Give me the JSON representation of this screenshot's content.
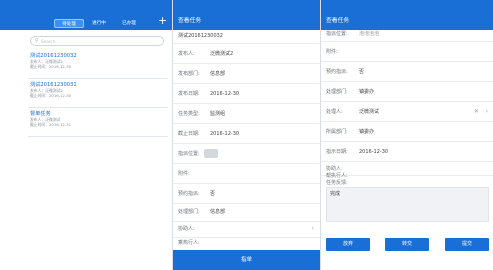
{
  "list_panel": {
    "tabs": [
      "待处理",
      "进行中",
      "已办理"
    ],
    "add_label": "+",
    "search_placeholder": "Search",
    "tasks": [
      {
        "title": "测试20161230032",
        "publisher": "发布人：泛微测试2",
        "deadline": "截止时间：2016-12-30"
      },
      {
        "title": "测试20161230031",
        "publisher": "发布人：泛微测试2",
        "deadline": "截止时间：2016-12-30"
      },
      {
        "title": "督单任务",
        "publisher": "发布人：泛微测试",
        "deadline": "截止时间：2016-12-31"
      }
    ]
  },
  "detail_panel": {
    "title": "查看任务",
    "task_name": "测试20161230032",
    "fields": [
      {
        "label": "发布人:",
        "value": "泛微测试2"
      },
      {
        "label": "发布部门:",
        "value": "信息部"
      },
      {
        "label": "发布日期:",
        "value": "2016-12-30"
      },
      {
        "label": "任务类型:",
        "value": "监测组"
      },
      {
        "label": "截止日期:",
        "value": "2016-12-30"
      },
      {
        "label": "指派位置:",
        "value": ""
      },
      {
        "label": "附件:",
        "value": ""
      },
      {
        "label": "预约指派:",
        "value": "否"
      },
      {
        "label": "处理部门:",
        "value": "信息部"
      },
      {
        "label": "协助人:",
        "value": ""
      },
      {
        "label": "乘热行人:",
        "value": ""
      }
    ],
    "bottom_button": "指单"
  },
  "process_panel": {
    "title": "查看任务",
    "fields": [
      {
        "label": "指派位置:",
        "value": "泡泡泡泡"
      },
      {
        "label": "附件:",
        "value": ""
      },
      {
        "label": "预约指派:",
        "value": "否"
      },
      {
        "label": "处理部门:",
        "value": "镇委办"
      },
      {
        "label": "处理人:",
        "value": "泛微测试"
      },
      {
        "label": "所属部门:",
        "value": "镇委办"
      },
      {
        "label": "指示日期:",
        "value": "2016-12-30"
      },
      {
        "label": "协助人:",
        "value": ""
      },
      {
        "label": "帮执行人:",
        "value": ""
      },
      {
        "label": "任务反馈:",
        "value": ""
      }
    ],
    "feedback_text": "完成",
    "buttons": [
      "放弃",
      "转交",
      "提交"
    ]
  },
  "colors": {
    "accent": "#1a6fd6",
    "border": "#d8dde6"
  }
}
